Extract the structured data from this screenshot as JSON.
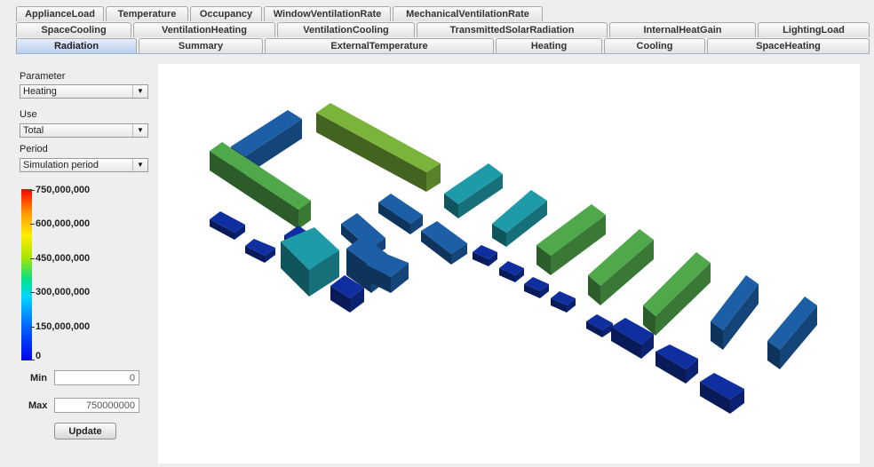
{
  "tabs": {
    "row1": [
      "ApplianceLoad",
      "Temperature",
      "Occupancy",
      "WindowVentilationRate",
      "MechanicalVentilationRate"
    ],
    "row2": [
      "SpaceCooling",
      "VentilationHeating",
      "VentilationCooling",
      "TransmittedSolarRadiation",
      "InternalHeatGain",
      "LightingLoad"
    ],
    "row3": [
      "Radiation",
      "Summary",
      "ExternalTemperature",
      "Heating",
      "Cooling",
      "SpaceHeating"
    ],
    "selected": "Radiation"
  },
  "controls": {
    "parameter_label": "Parameter",
    "parameter_value": "Heating",
    "use_label": "Use",
    "use_value": "Total",
    "period_label": "Period",
    "period_value": "Simulation period"
  },
  "colorbar": {
    "ticks": [
      "750,000,000",
      "600,000,000",
      "450,000,000",
      "300,000,000",
      "150,000,000",
      "0"
    ]
  },
  "range": {
    "min_label": "Min",
    "min_value": "0",
    "max_label": "Max",
    "max_value": "750000000",
    "update_label": "Update"
  },
  "scene": {
    "colors": {
      "green": "#4fa84a",
      "yellowgreen": "#7bb43a",
      "teal": "#1f9aa8",
      "blue": "#1c5fa6",
      "navy": "#0f2fa0"
    }
  }
}
